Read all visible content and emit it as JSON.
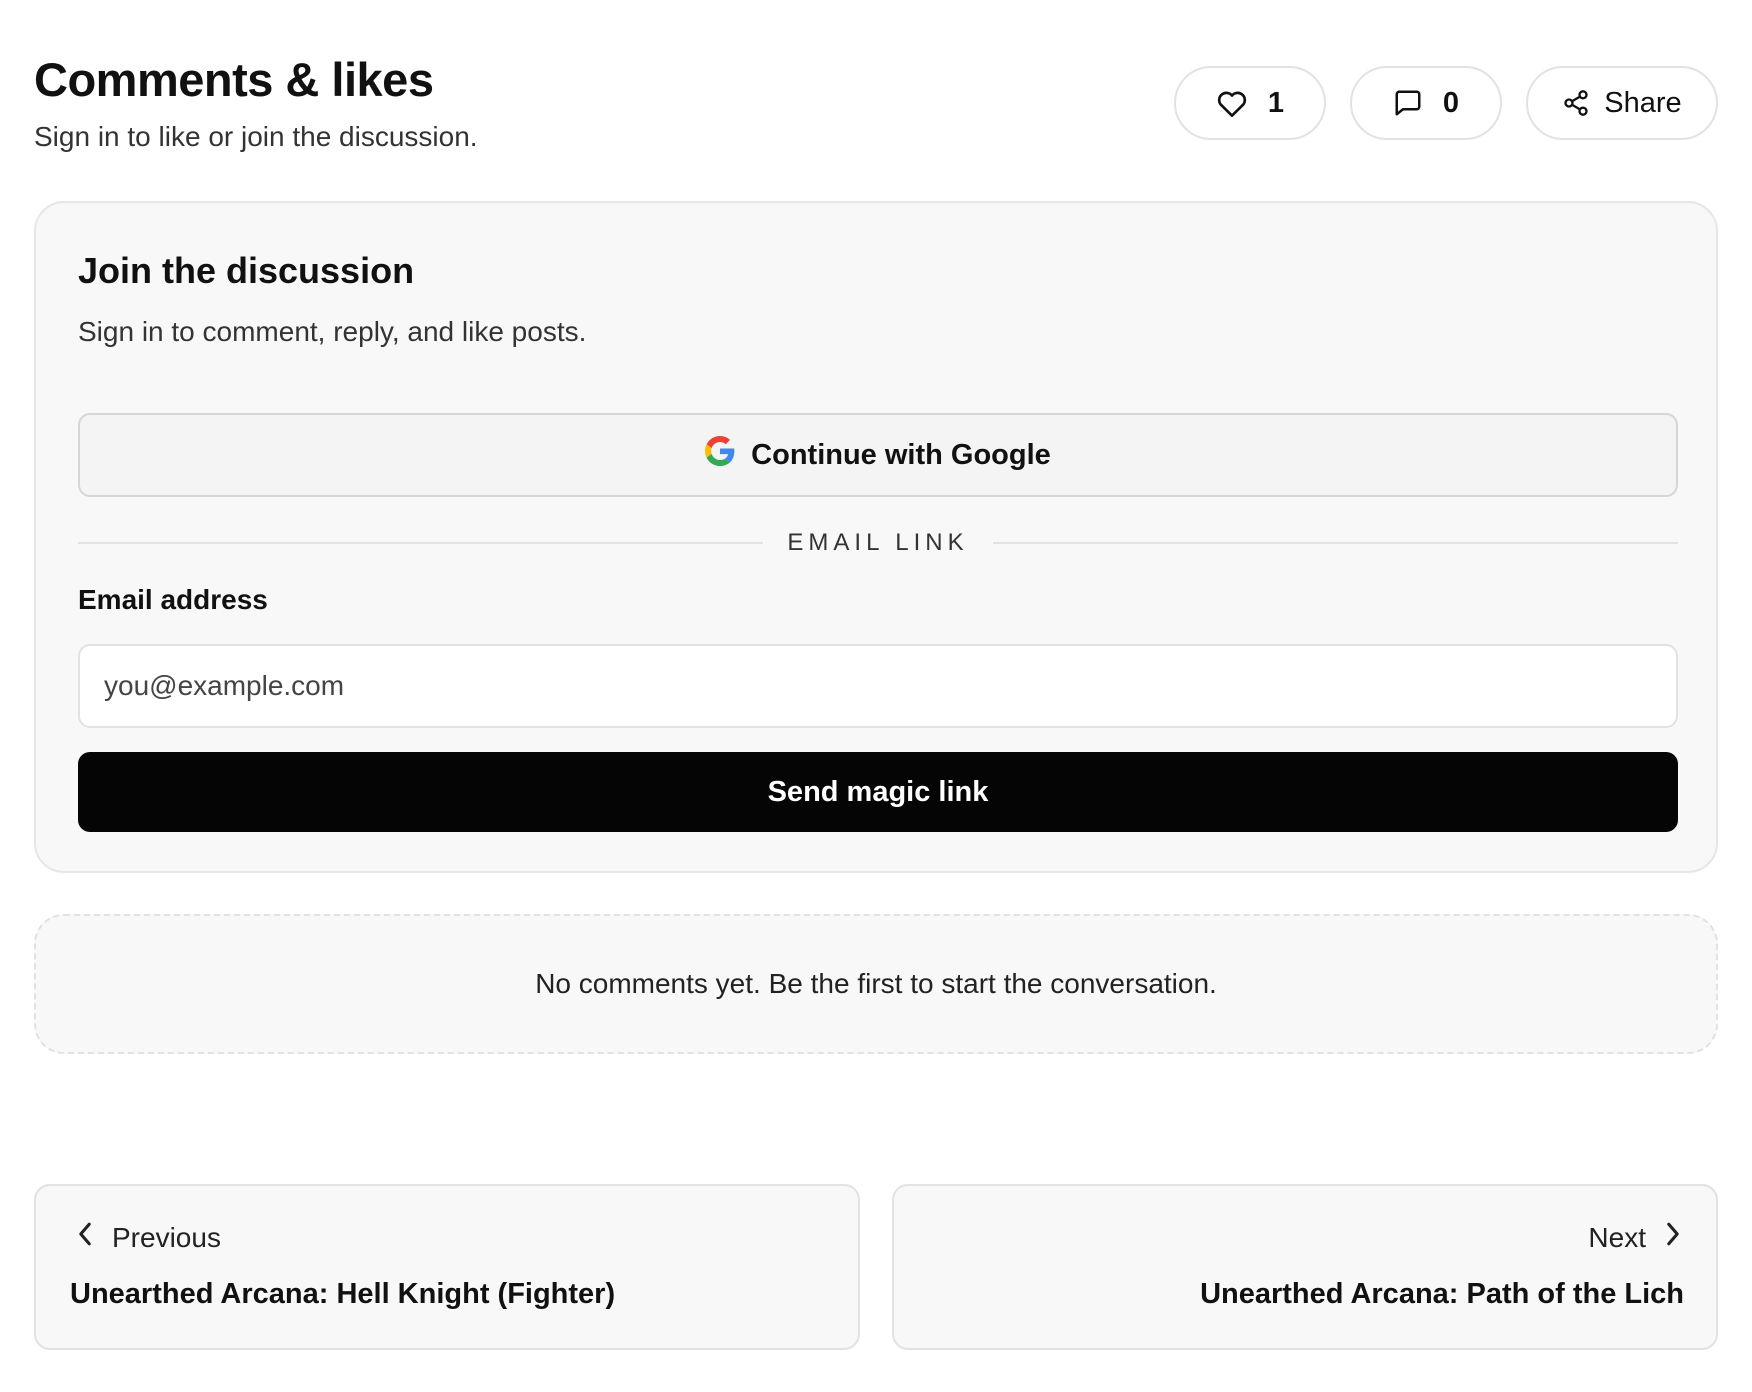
{
  "header": {
    "title": "Comments & likes",
    "subtitle": "Sign in to like or join the discussion.",
    "like_count": "1",
    "comment_count": "0",
    "share_label": "Share"
  },
  "signin": {
    "title": "Join the discussion",
    "subtitle": "Sign in to comment, reply, and like posts.",
    "google_label": "Continue with Google",
    "divider_label": "EMAIL LINK",
    "email_label": "Email address",
    "email_placeholder": "you@example.com",
    "email_value": "",
    "submit_label": "Send magic link"
  },
  "comments": {
    "empty_text": "No comments yet. Be the first to start the conversation."
  },
  "post_nav": {
    "previous": {
      "direction_label": "Previous",
      "title": "Unearthed Arcana: Hell Knight (Fighter)"
    },
    "next": {
      "direction_label": "Next",
      "title": "Unearthed Arcana: Path of the Lich"
    }
  },
  "icons": {
    "like": "heart-icon",
    "comment": "message-square-icon",
    "share": "share-icon",
    "google": "google-logo-icon",
    "previous": "chevron-left-icon",
    "next": "chevron-right-icon"
  },
  "colors": {
    "primary_button": "#050505",
    "card_background": "#f8f8f8",
    "border": "#e2e2e2"
  }
}
